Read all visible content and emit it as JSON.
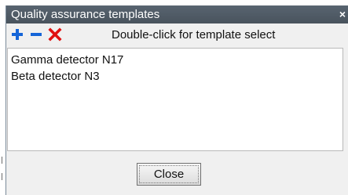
{
  "dialog": {
    "title": "Quality assurance templates",
    "close_glyph": "×"
  },
  "toolbar": {
    "add_icon": "plus-icon",
    "remove_icon": "minus-icon",
    "delete_icon": "delete-x-icon",
    "hint": "Double-click for template select",
    "colors": {
      "add": "#1565d8",
      "remove": "#1565d8",
      "delete": "#e01010"
    }
  },
  "templates": {
    "items": [
      {
        "label": "Gamma detector N17"
      },
      {
        "label": "Beta detector N3"
      }
    ]
  },
  "footer": {
    "close_label": "Close"
  }
}
